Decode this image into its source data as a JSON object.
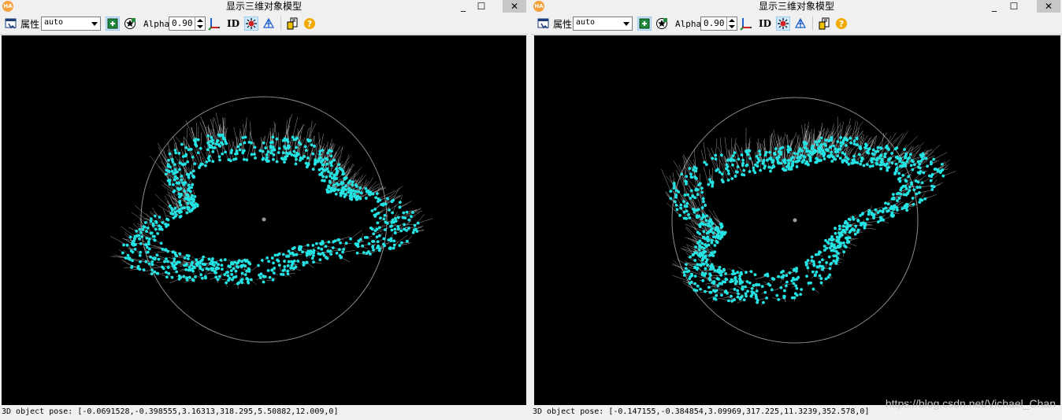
{
  "app": {
    "logo_text": "HA",
    "window_title": "显示三维对象模型"
  },
  "window_controls": [
    "_",
    "☐",
    "✕"
  ],
  "toolbar": {
    "properties_label": "属性",
    "mode_select_value": "auto",
    "alpha_label": "Alpha",
    "alpha_value": "0.90",
    "id_label": "ID",
    "icons": [
      "window-properties-icon",
      "pose-icon",
      "star-icon",
      "axes-icon",
      "id-icon",
      "lighting-icon",
      "wireframe-icon",
      "save-icon",
      "help-icon"
    ]
  },
  "colors": {
    "points": "#23e4e4",
    "normals": "#c8c8c8",
    "circle": "#8c8c8c",
    "center": "#9a9a9a",
    "canvas": "#000000",
    "help": "#f2a900",
    "logo": "#f5a13c"
  },
  "windows": [
    {
      "pose_label": "3D object pose:",
      "pose_value": "[-0.0691528,-0.398555,3.16313,318.295,5.50882,12.009,0]"
    },
    {
      "pose_label": "3D object pose:",
      "pose_value": "[-0.147155,-0.384854,3.09969,317.225,11.3239,352.578,0]"
    }
  ],
  "watermark": "https://blog.csdn.net/Vichael_Chan"
}
